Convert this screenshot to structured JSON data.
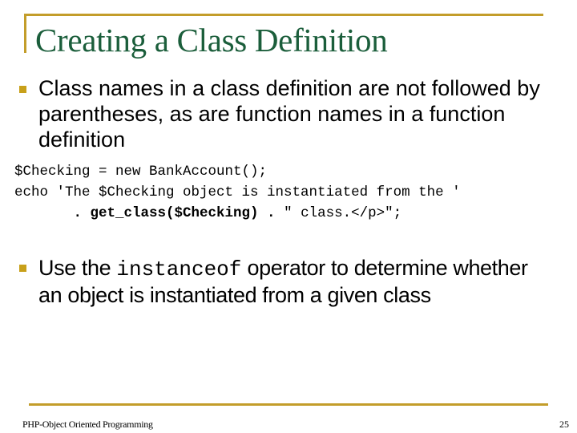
{
  "slide": {
    "title": "Creating a Class Definition",
    "bullets": [
      {
        "text": "Class names in a class definition are not followed by parentheses, as are function names in a function definition"
      },
      {
        "text_before": "Use the ",
        "code": "instanceof",
        "text_after": " operator to determine whether an object is instantiated from a given class"
      }
    ],
    "code_block": {
      "line1": "$Checking = new BankAccount();",
      "line2": "echo 'The $Checking object is instantiated from the '",
      "line3_indent": "       ",
      "line3_bold": ". get_class($Checking) .",
      "line3_regular": " \" class.</p>\";"
    },
    "footer": {
      "course": "PHP-Object Oriented Programming",
      "page_number": "25"
    },
    "colors": {
      "accent": "#c39d2a",
      "title": "#1b5e3b",
      "bullet": "#c8a01a"
    }
  }
}
